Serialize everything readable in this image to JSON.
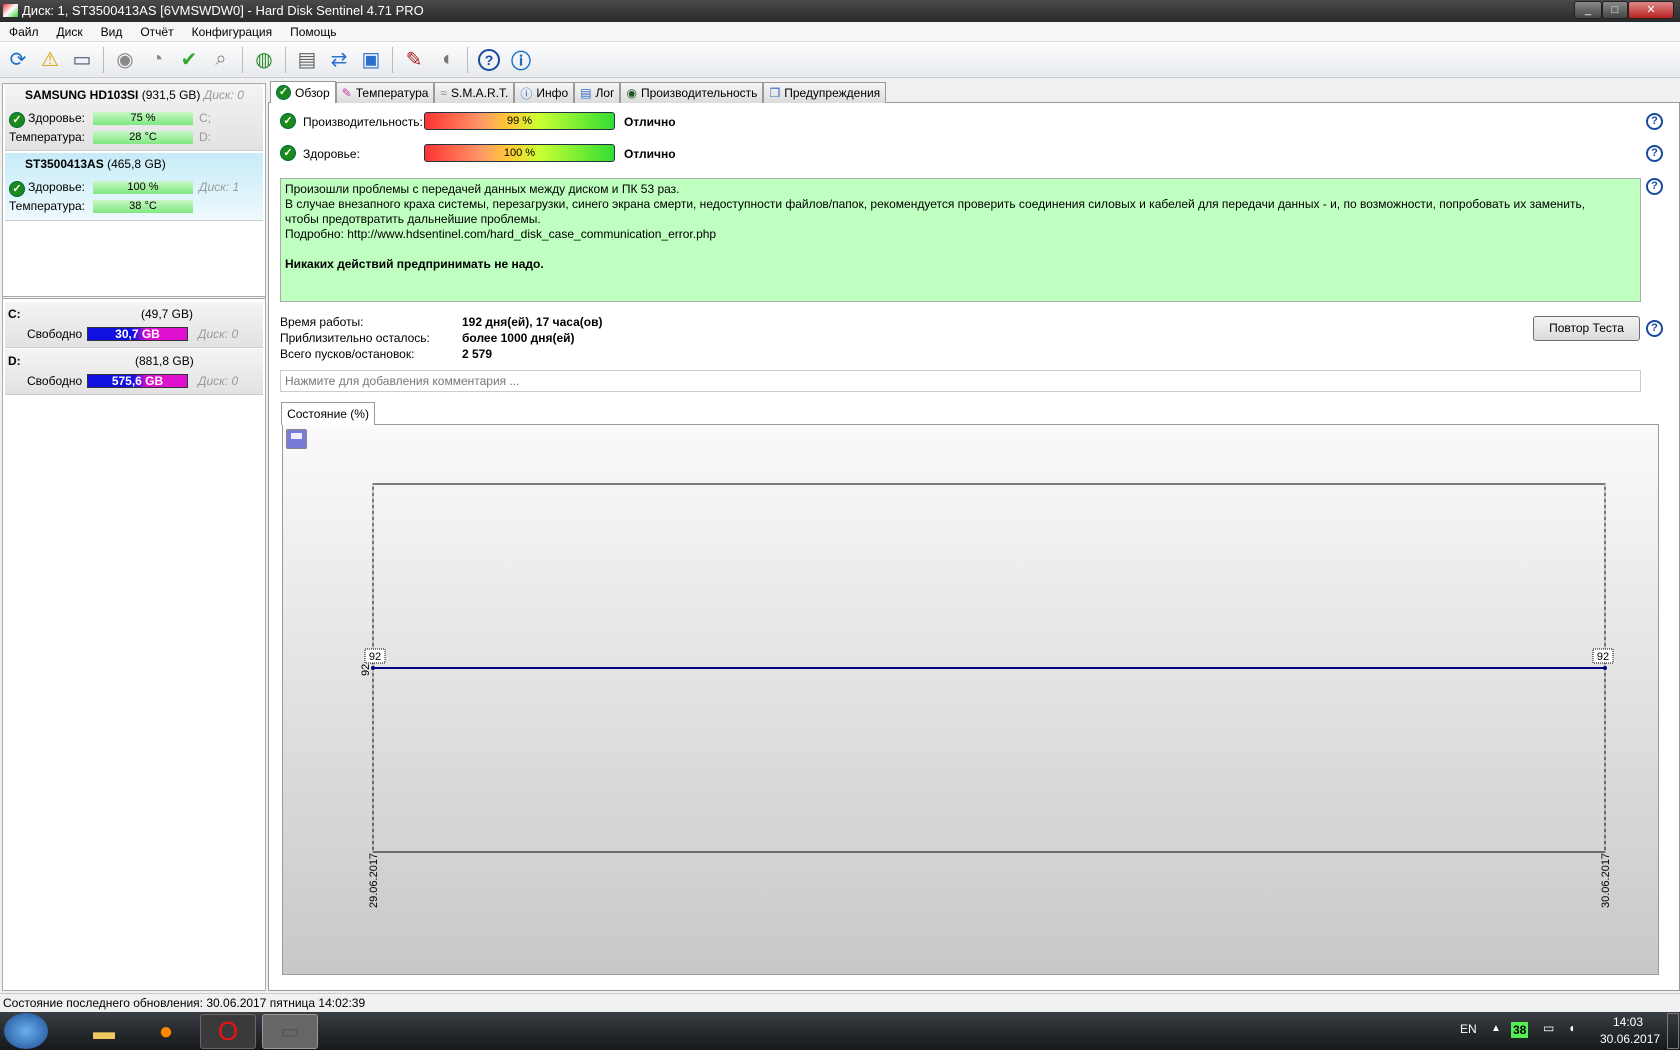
{
  "window": {
    "title": "Диск: 1, ST3500413AS [6VMSWDW0]  -  Hard Disk Sentinel 4.71 PRO"
  },
  "menu": [
    "Файл",
    "Диск",
    "Вид",
    "Отчёт",
    "Конфигурация",
    "Помощь"
  ],
  "disks": [
    {
      "name": "SAMSUNG HD103SI",
      "size": "(931,5 GB)",
      "disk": "Диск: 0",
      "health_label": "Здоровье:",
      "health": "75 %",
      "temp_label": "Температура:",
      "temp": "28 °C",
      "vol1": "C;",
      "vol2": "D:"
    },
    {
      "name": "ST3500413AS",
      "size": "(465,8 GB)",
      "disk": "Диск: 1",
      "health_label": "Здоровье:",
      "health": "100 %",
      "temp_label": "Температура:",
      "temp": "38 °C"
    }
  ],
  "volumes": [
    {
      "letter": "C:",
      "size": "(49,7 GB)",
      "free_label": "Свободно",
      "free": "30,7 GB",
      "disk": "Диск: 0",
      "used_fraction": 0.38
    },
    {
      "letter": "D:",
      "size": "(881,8 GB)",
      "free_label": "Свободно",
      "free": "575,6 GB",
      "disk": "Диск: 0",
      "used_fraction": 0.35
    }
  ],
  "tabs": [
    "Обзор",
    "Температура",
    "S.M.A.R.T.",
    "Инфо",
    "Лог",
    "Производительность",
    "Предупреждения"
  ],
  "overview": {
    "perf_label": "Производительность:",
    "perf_value": "99 %",
    "perf_percent": 99,
    "perf_status": "Отлично",
    "health_label": "Здоровье:",
    "health_value": "100 %",
    "health_percent": 100,
    "health_status": "Отлично",
    "message": [
      "Произошли проблемы с передачей данных между диском и ПК 53 раз.",
      "В случае внезапного краха системы, перезагрузки, синего экрана смерти, недоступности файлов/папок, рекомендуется проверить соединения силовых и кабелей для передачи данных - и, по возможности, попробовать их заменить,",
      "чтобы предотвратить дальнейшие проблемы.",
      "Подробно: http://www.hdsentinel.com/hard_disk_case_communication_error.php"
    ],
    "message_bold": "Никаких действий предпринимать не надо.",
    "uptime_label": "Время работы:",
    "uptime": "192 дня(ей), 17 часа(ов)",
    "remaining_label": "Приблизительно осталось:",
    "remaining": "более 1000 дня(ей)",
    "starts_label": "Всего пусков/остановок:",
    "starts": "2 579",
    "retest_button": "Повтор Теста",
    "comment_placeholder": "Нажмите для добавления комментария ...",
    "chart_tab": "Состояние (%)"
  },
  "chart_data": {
    "type": "line",
    "title": "Состояние (%)",
    "x": [
      "29.06.2017",
      "30.06.2017"
    ],
    "values": [
      92,
      92
    ],
    "data_labels": [
      "92",
      "92"
    ],
    "ytick": "92",
    "ylim": [
      91,
      93
    ],
    "color": "#000080"
  },
  "statusbar": "Состояние последнего обновления: 30.06.2017 пятница 14:02:39",
  "taskbar": {
    "lang": "EN",
    "tray_temp": "38",
    "time": "14:03",
    "date": "30.06.2017"
  }
}
